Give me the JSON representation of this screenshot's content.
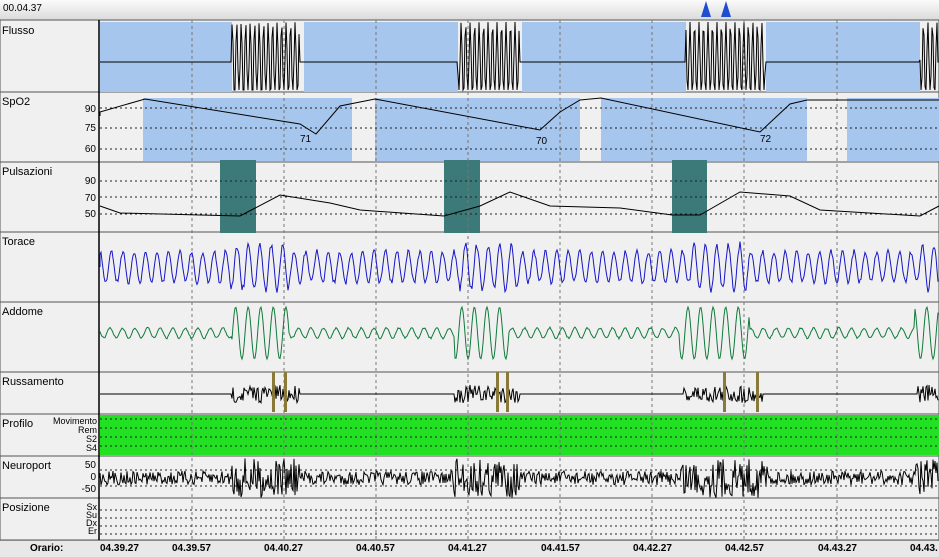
{
  "header": {
    "time": "00.04.37"
  },
  "channels": {
    "flusso": "Flusso",
    "spo2": "SpO2",
    "pulsazioni": "Pulsazioni",
    "torace": "Torace",
    "addome": "Addome",
    "russamento": "Russamento",
    "profilo": "Profilo",
    "neuroport": "Neuroport",
    "posizione": "Posizione"
  },
  "spo2_scale": [
    "90",
    "75",
    "60"
  ],
  "spo2_nadirs": [
    "71",
    "70",
    "72"
  ],
  "pulse_scale": [
    "90",
    "70",
    "50"
  ],
  "sleep_stages": [
    "Movimento",
    "Rem",
    "S2",
    "S4"
  ],
  "neuro_scale": [
    "50",
    "0",
    "-50"
  ],
  "positions": [
    "Sx",
    "Su",
    "Dx",
    "Er"
  ],
  "footer": {
    "orario": "Orario:",
    "times": [
      "04.39.27",
      "04.39.57",
      "04.40.27",
      "04.40.57",
      "04.41.27",
      "04.41.57",
      "04.42.27",
      "04.42.57",
      "04.43.27",
      "04.43."
    ]
  },
  "colors": {
    "desat": "#a6c6ee",
    "pulse_event": "#3b7a78",
    "profile": "#22e022",
    "torace": "#1515c8",
    "addome": "#107a3a",
    "marker": "#1f4fd1"
  }
}
